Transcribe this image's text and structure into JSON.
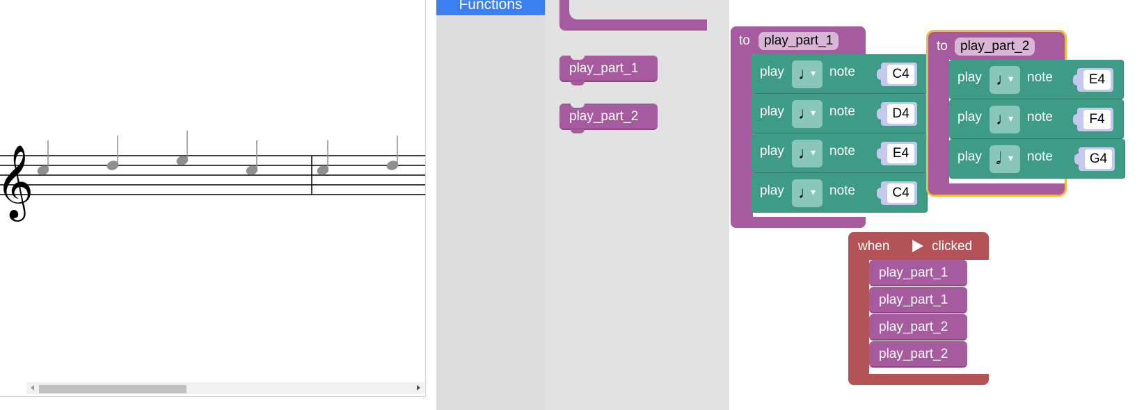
{
  "music": {
    "staff_color": "#000000",
    "note_color": "#8f8f8f",
    "clef_glyph": "𝄞"
  },
  "toolbox": {
    "selected_category": "Functions",
    "accent": "#3b7ff0"
  },
  "flyout": {
    "blocks": [
      {
        "label": "play_part_1"
      },
      {
        "label": "play_part_2"
      }
    ]
  },
  "workspace": {
    "proc1": {
      "keyword": "to",
      "name": "play_part_1",
      "rows": [
        {
          "play": "play",
          "duration_icon": "quarter-note-icon",
          "note_label": "note",
          "note": "C4"
        },
        {
          "play": "play",
          "duration_icon": "quarter-note-icon",
          "note_label": "note",
          "note": "D4"
        },
        {
          "play": "play",
          "duration_icon": "quarter-note-icon",
          "note_label": "note",
          "note": "E4"
        },
        {
          "play": "play",
          "duration_icon": "quarter-note-icon",
          "note_label": "note",
          "note": "C4"
        }
      ]
    },
    "proc2": {
      "keyword": "to",
      "name": "play_part_2",
      "rows": [
        {
          "play": "play",
          "duration_icon": "quarter-note-icon",
          "note_label": "note",
          "note": "E4"
        },
        {
          "play": "play",
          "duration_icon": "quarter-note-icon",
          "note_label": "note",
          "note": "F4"
        },
        {
          "play": "play",
          "duration_icon": "half-note-icon",
          "note_label": "note",
          "note": "G4"
        }
      ]
    },
    "event": {
      "when": "when",
      "clicked": "clicked",
      "calls": [
        "play_part_1",
        "play_part_1",
        "play_part_2",
        "play_part_2"
      ]
    }
  },
  "colors": {
    "procedure": "#a55b9e",
    "music_block": "#3d9b86",
    "event": "#b45357",
    "selection_outline": "#f6b93b"
  }
}
